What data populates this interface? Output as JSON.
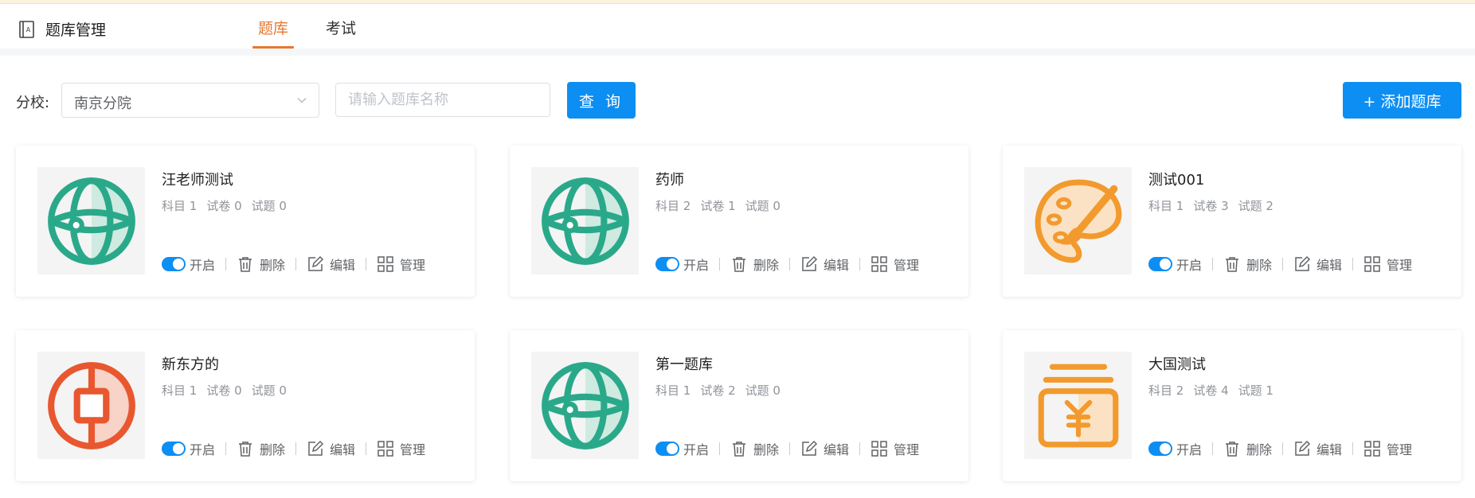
{
  "header": {
    "title": "题库管理",
    "tabs": [
      {
        "label": "题库",
        "active": true
      },
      {
        "label": "考试",
        "active": false
      }
    ]
  },
  "filter": {
    "branch_label": "分校:",
    "branch_value": "南京分院",
    "search_placeholder": "请输入题库名称",
    "query_button": "查 询",
    "add_button": "+ 添加题库"
  },
  "actions": {
    "enable": "开启",
    "delete": "删除",
    "edit": "编辑",
    "manage": "管理"
  },
  "cards": [
    {
      "name": "汪老师测试",
      "subjects": "科目 1",
      "papers": "试卷 0",
      "questions": "试题 0",
      "icon": "globe-icon",
      "color": "#2aa98a",
      "enabled": true
    },
    {
      "name": "药师",
      "subjects": "科目 2",
      "papers": "试卷 1",
      "questions": "试题 0",
      "icon": "globe-icon",
      "color": "#2aa98a",
      "enabled": true
    },
    {
      "name": "测试001",
      "subjects": "科目 1",
      "papers": "试卷 3",
      "questions": "试题 2",
      "icon": "palette-icon",
      "color": "#f29a2e",
      "enabled": true
    },
    {
      "name": "新东方的",
      "subjects": "科目 1",
      "papers": "试卷 0",
      "questions": "试题 0",
      "icon": "coin-icon",
      "color": "#e8572f",
      "enabled": true
    },
    {
      "name": "第一题库",
      "subjects": "科目 1",
      "papers": "试卷 2",
      "questions": "试题 0",
      "icon": "globe-icon",
      "color": "#2aa98a",
      "enabled": true
    },
    {
      "name": "大国测试",
      "subjects": "科目 2",
      "papers": "试卷 4",
      "questions": "试题 1",
      "icon": "money-jar-icon",
      "color": "#f29a2e",
      "enabled": true
    }
  ],
  "colors": {
    "primary": "#0d8ef3",
    "tab_active": "#e8772e"
  }
}
